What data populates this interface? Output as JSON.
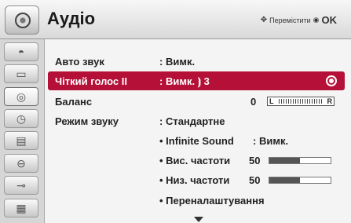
{
  "header": {
    "title": "Аудіо",
    "nav_hint": "Перемістити",
    "ok_label": "OK"
  },
  "menu": [
    {
      "label": "Авто звук",
      "value": ": Вимк."
    },
    {
      "label": "Чіткий голос II",
      "value": ": Вимк. ⦘ 3"
    },
    {
      "label": "Баланс",
      "value": "0"
    },
    {
      "label": "Режим звуку",
      "value": ": Стандартне"
    }
  ],
  "balance": {
    "left": "L",
    "right": "R"
  },
  "sub_menu": [
    {
      "label": "• Infinite Sound",
      "value": ": Вимк."
    },
    {
      "label": "• Вис. частоти",
      "value": "50",
      "level": 0.5
    },
    {
      "label": "• Низ. частоти",
      "value": "50",
      "level": 0.5
    },
    {
      "label": "• Переналаштування"
    }
  ],
  "sidebar_icons": [
    "picture-icon",
    "monitor-icon",
    "audio-icon",
    "clock-icon",
    "option-icon",
    "lock-icon",
    "input-icon",
    "usb-icon"
  ]
}
